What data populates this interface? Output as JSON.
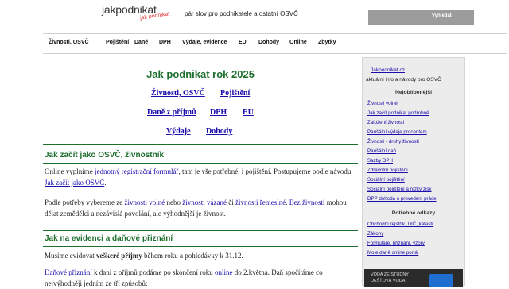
{
  "header": {
    "logo_main": "jakpodnikat",
    "logo_sub": "jak podnikat",
    "tagline": "pár slov pro podnikatele a ostatní OSVČ",
    "search_button": "Vyhledat"
  },
  "nav": [
    "Živnosti, OSVČ",
    "Pojištění",
    "Daně",
    "DPH",
    "Výdaje, evidence",
    "EU",
    "Dohody",
    "Online",
    "Zbytky"
  ],
  "main": {
    "title": "Jak podnikat rok 2025",
    "quicklinks": {
      "zivnosti": "Živnosti, OSVČ",
      "pojisteni": "Pojištění",
      "dane": "Daně z příjmů",
      "dph": "DPH",
      "eu": "EU",
      "vydaje": "Výdaje",
      "dohody": "Dohody"
    },
    "section1_title": "Jak začít jako OSVČ, živnostník",
    "p1": {
      "t1": "Online vyplníme ",
      "l1": "jednotný registrační formulář",
      "t2": ", tam je vše potřebné, i pojištění. Postupujeme podle návodu ",
      "l2": "Jak začít jako OSVČ",
      "t3": "."
    },
    "p2": {
      "t1": "Podle potřeby vybereme ze ",
      "l1": "živnosti volné",
      "t2": " nebo ",
      "l2": "živnosti vázané",
      "t3": " či ",
      "l3": "živnosti řemeslné",
      "t4": ". ",
      "l4": "Bez živnosti",
      "t5": " mohou dělat zemědělci a nezávislá povolání, ale výhodnější je živnost."
    },
    "section2_title": "Jak na evidenci a daňové přiznání",
    "p3": {
      "t1": "Musíme evidovat ",
      "b1": "veškeré příjmy",
      "t2": " během roku a pohledávky k 31.12."
    },
    "p4": {
      "l1": "Daňové přiznání",
      "t1": " k dani z příjmů podáme po skončení roku ",
      "l2": "online",
      "t2": " do 2.května. Daň spočítáme co nejvýhodněji jedním ze tří způsobů:"
    }
  },
  "sidebar": {
    "top_link": "Jakpodnikat.cz",
    "top_desc": "aktuální info a návody pro OSVČ",
    "h1": "Nejoblíbenější",
    "popular": [
      "Živnosti volné",
      "Jak začít podnikat podrobně",
      "Založení živnosti",
      "Paušální výdaje procentem",
      "Živnosti - druhy živností",
      "Paušální daň",
      "Sazby DPH",
      "Zdravotní pojištění",
      "Sociální pojištění",
      "Sociální pojištění a nízký zisk",
      "DPP dohoda o provedení práce"
    ],
    "h2": "Potřebné odkazy",
    "useful": [
      "Obchodní rejstřík, DIČ, katastr",
      "Zákony",
      "Formuláře, přiznání, vzory",
      "Moje daně online portál"
    ],
    "ad_line1": "VODA ZE STUDNY",
    "ad_line2": "DEŠŤOVÁ VODA"
  }
}
